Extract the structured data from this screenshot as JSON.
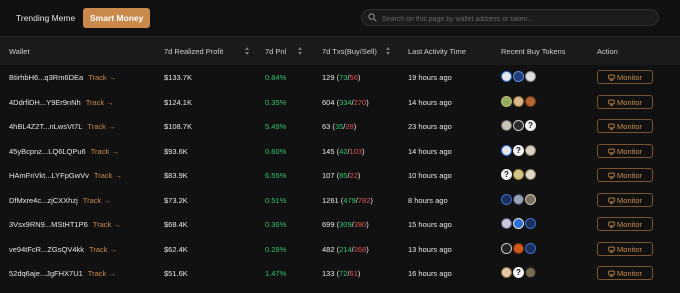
{
  "tabs": [
    {
      "label": "Trending Meme"
    },
    {
      "label": "Smart Money"
    }
  ],
  "search": {
    "placeholder": "Search on this page by wallet address or token..."
  },
  "columns": {
    "wallet": "Wallet",
    "profit": "7d Realized Profit",
    "pnl": "7d Pnl",
    "txs": "7d Txs(Buy/Sell)",
    "activity": "Last Activity Time",
    "tokens": "Recent Buy Tokens",
    "action": "Action"
  },
  "track_label": "Track",
  "monitor_label": "Monitor",
  "colors": {
    "accent": "#c98a4b",
    "positive": "#2ec46e",
    "negative": "#e05555"
  },
  "rows": [
    {
      "wallet": "BtirhbH6...q3Rm6DEa",
      "profit": "$133.7K",
      "pnl": "0.84%",
      "total": "129",
      "buy": "73",
      "sell": "56",
      "activity": "19 hours ago",
      "tokens": [
        {
          "bg": "#e8e8e8",
          "ring": "#2a6fd6"
        },
        {
          "bg": "#1f3d7a",
          "ring": "#5a8be0"
        },
        {
          "bg": "#dcdcdc",
          "ring": "#888"
        }
      ]
    },
    {
      "wallet": "4DdrfiDH...Y9Er9nNh",
      "profit": "$124.1K",
      "pnl": "0.35%",
      "total": "604",
      "buy": "334",
      "sell": "270",
      "activity": "14 hours ago",
      "tokens": [
        {
          "bg": "#8fb05a",
          "ring": "#c9b37c"
        },
        {
          "bg": "#d8b98c",
          "ring": "#8a6b3c"
        },
        {
          "bg": "#b8642e",
          "ring": "#6b3a1a"
        }
      ]
    },
    {
      "wallet": "4hBL4Z2T...nLwsVt7L",
      "profit": "$108.7K",
      "pnl": "5.49%",
      "total": "63",
      "buy": "35",
      "sell": "28",
      "activity": "23 hours ago",
      "tokens": [
        {
          "bg": "#c9c3b6",
          "ring": "#6b6b6b"
        },
        {
          "bg": "#2a2a2a",
          "ring": "#cfcfcf"
        },
        {
          "q": "?"
        }
      ]
    },
    {
      "wallet": "45yBcpnz...LQ6LQPu6",
      "profit": "$93.6K",
      "pnl": "0.60%",
      "total": "145",
      "buy": "42",
      "sell": "103",
      "activity": "14 hours ago",
      "tokens": [
        {
          "bg": "#e6e6e6",
          "ring": "#2a6fd6"
        },
        {
          "q": "?"
        },
        {
          "bg": "#d9d2c4",
          "ring": "#8a7d63"
        }
      ]
    },
    {
      "wallet": "HAmFnVkt...LYFpGwVv",
      "profit": "$83.9K",
      "pnl": "6.55%",
      "total": "107",
      "buy": "85",
      "sell": "22",
      "activity": "10 hours ago",
      "tokens": [
        {
          "q": "?"
        },
        {
          "bg": "#d4c48a",
          "ring": "#a08a3a"
        },
        {
          "bg": "#e0d8c0",
          "ring": "#8a7d63"
        }
      ]
    },
    {
      "wallet": "DfMxre4c...zjCXXhzj",
      "profit": "$73.2K",
      "pnl": "0.51%",
      "total": "1261",
      "buy": "479",
      "sell": "782",
      "activity": "8 hours ago",
      "tokens": [
        {
          "bg": "#1b2f5e",
          "ring": "#3a6fd0"
        },
        {
          "bg": "#9aa4b2",
          "ring": "#3a4a66"
        },
        {
          "bg": "#7a7060",
          "ring": "#cfc7b0"
        }
      ]
    },
    {
      "wallet": "3Vsx9RN9...MStHT1P6",
      "profit": "$68.4K",
      "pnl": "0.36%",
      "total": "699",
      "buy": "309",
      "sell": "390",
      "activity": "15 hours ago",
      "tokens": [
        {
          "bg": "#c8c8d8",
          "ring": "#5a5a8a"
        },
        {
          "bg": "#2a6fd6",
          "ring": "#e6e6e6"
        },
        {
          "bg": "#1b2f5e",
          "ring": "#3a6fd0"
        }
      ]
    },
    {
      "wallet": "ve94tFcR...ZGsQV4kk",
      "profit": "$62.4K",
      "pnl": "0.28%",
      "total": "482",
      "buy": "214",
      "sell": "268",
      "activity": "13 hours ago",
      "tokens": [
        {
          "bg": "#222",
          "ring": "#cfcfcf"
        },
        {
          "bg": "#d35a1e",
          "ring": "#7a2f0a"
        },
        {
          "bg": "#1b2f5e",
          "ring": "#3a6fd0"
        }
      ]
    },
    {
      "wallet": "52dq6aje...JgFHX7U1",
      "profit": "$51.6K",
      "pnl": "1.47%",
      "total": "133",
      "buy": "72",
      "sell": "61",
      "activity": "16 hours ago",
      "tokens": [
        {
          "bg": "#e3c9a8",
          "ring": "#8a6b3c"
        },
        {
          "q": "?"
        },
        {
          "bg": "#7a6a50",
          "ring": "#2a2a2a"
        }
      ]
    }
  ]
}
